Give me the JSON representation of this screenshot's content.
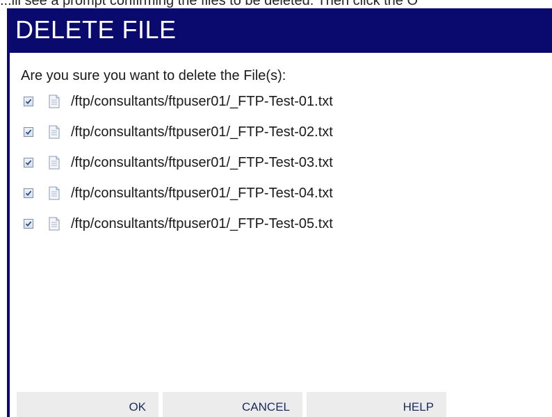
{
  "caption": {
    "text": "...ill see a prompt confirming the files to be deleted.  Then click the O"
  },
  "dialog": {
    "title": "DELETE FILE",
    "prompt": "Are you sure you want to delete the File(s):",
    "files": [
      {
        "path": "/ftp/consultants/ftpuser01/_FTP-Test-01.txt",
        "checked": true
      },
      {
        "path": "/ftp/consultants/ftpuser01/_FTP-Test-02.txt",
        "checked": true
      },
      {
        "path": "/ftp/consultants/ftpuser01/_FTP-Test-03.txt",
        "checked": true
      },
      {
        "path": "/ftp/consultants/ftpuser01/_FTP-Test-04.txt",
        "checked": true
      },
      {
        "path": "/ftp/consultants/ftpuser01/_FTP-Test-05.txt",
        "checked": true
      }
    ],
    "buttons": {
      "ok": "OK",
      "cancel": "CANCEL",
      "help": "HELP"
    }
  },
  "colors": {
    "title_bar": "#0a0a6e",
    "button_bg": "#ececec",
    "button_text": "#1a2c5a"
  },
  "icons": {
    "checkbox": "checkbox-checked-icon",
    "file": "text-file-icon"
  }
}
